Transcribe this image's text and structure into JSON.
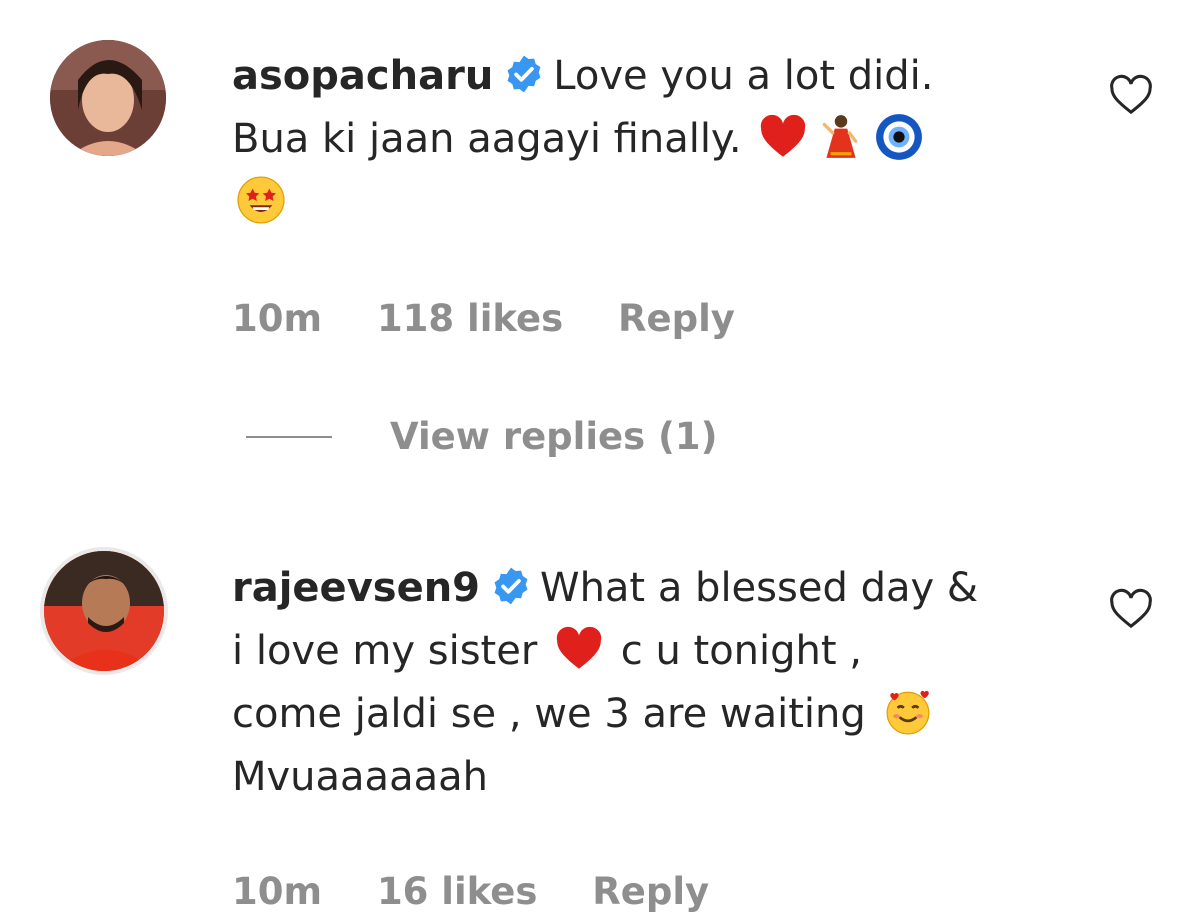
{
  "comments": [
    {
      "username": "asopacharu",
      "verified": true,
      "text_line1": "Love you a lot didi.",
      "text_line2": "Bua ki jaan aagayi finally.",
      "emojis": [
        "red-heart-emoji",
        "woman-dancing-emoji",
        "nazar-amulet-emoji",
        "star-struck-face-emoji"
      ],
      "time": "10m",
      "likes": "118 likes",
      "reply_label": "Reply",
      "view_replies_label": "View replies (1)"
    },
    {
      "username": "rajeevsen9",
      "verified": true,
      "text_line1": "What a blessed day &",
      "text_line2a": "i love my sister",
      "text_line2b": "c u tonight ,",
      "text_line3": "come jaldi se , we 3 are waiting",
      "text_line4": "Mvuaaaaaah",
      "emojis": [
        "red-heart-emoji",
        "smiling-face-with-hearts-emoji"
      ],
      "time": "10m",
      "likes": "16 likes",
      "reply_label": "Reply"
    }
  ],
  "colors": {
    "text": "#262626",
    "meta": "#8e8e8e",
    "verified": "#3897f0",
    "heart_emoji": "#e0201b"
  }
}
